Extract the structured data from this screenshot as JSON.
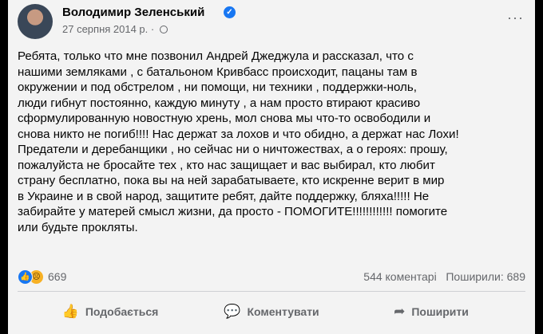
{
  "post": {
    "author": "Володимир Зеленський",
    "date": "27 серпня 2014 р.",
    "separator": "·",
    "more_label": "···",
    "text": "Ребята, только что мне позвонил Андрей Джеджула и рассказал, что с\nнашими земляками , с батальоном Кривбасс происходит, пацаны там в\nокружении и под обстрелом , ни помощи, ни техники , поддержки-ноль,\nлюди гибнут постоянно, каждую минуту , а нам просто втирают красиво\nсформулированную новостную хрень, мол снова мы что-то освободили и\nснова никто не погиб!!!! Нас держат за лохов и что обидно, а держат нас Лохи!\nПредатели и деребанщики , но сейчас ни о ничтожествах, а о героях: прошу,\nпожалуйста не бросайте тех , кто нас защищает и вас выбирал, кто любит\nстрану бесплатно, пока вы на ней зарабатываете, кто искренне верит в мир\nв Украине и в свой народ, защитите ребят, дайте поддержку, бляха!!!!! Не\nзабирайте у матерей смысл жизни, да просто - ПОМОГИТЕ!!!!!!!!!!!!  помогите\nили будьте прокляты."
  },
  "stats": {
    "reactions_count": "669",
    "comments": "544 коментарі",
    "shares": "Поширили: 689"
  },
  "actions": {
    "like": "Подобається",
    "comment": "Коментувати",
    "share": "Поширити"
  }
}
